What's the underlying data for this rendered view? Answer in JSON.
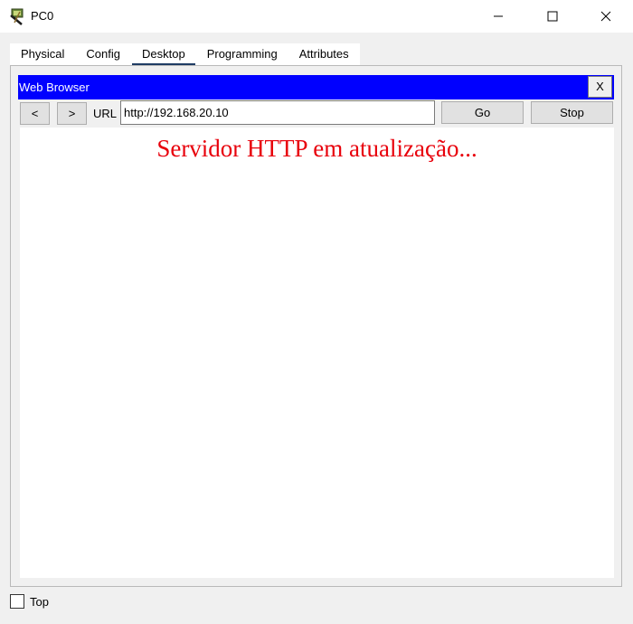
{
  "window": {
    "title": "PC0"
  },
  "tabs": [
    {
      "label": "Physical"
    },
    {
      "label": "Config"
    },
    {
      "label": "Desktop"
    },
    {
      "label": "Programming"
    },
    {
      "label": "Attributes"
    }
  ],
  "active_tab": "Desktop",
  "browser": {
    "title": "Web Browser",
    "close_label": "X",
    "back_label": "<",
    "forward_label": ">",
    "url_label": "URL",
    "url_value": "http://192.168.20.10",
    "go_label": "Go",
    "stop_label": "Stop",
    "content_text": "Servidor HTTP em atualização...",
    "header_color": "#0000ff",
    "content_text_color": "#e8000b"
  },
  "footer": {
    "top_label": "Top",
    "top_checked": false
  },
  "icons": {
    "app": "pc-device-icon",
    "minimize": "minimize-icon",
    "maximize": "maximize-icon",
    "close": "close-icon"
  }
}
